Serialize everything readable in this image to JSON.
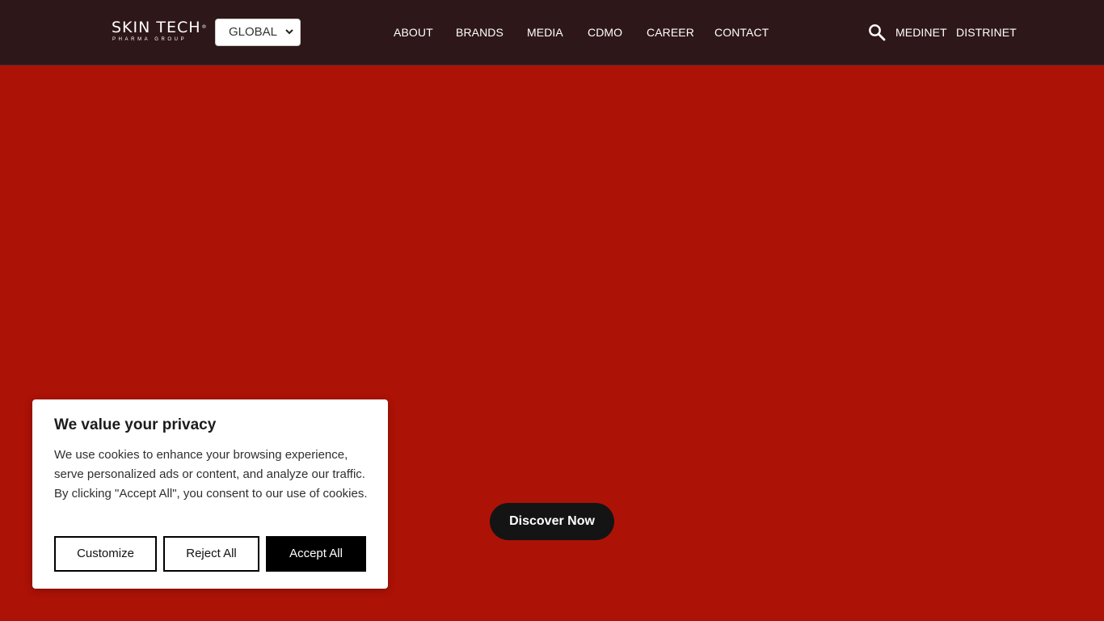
{
  "header": {
    "logo": {
      "main": "SKIN TECH",
      "registered": "®",
      "sub": "PHARMA GROUP"
    },
    "region_select": {
      "selected": "GLOBAL"
    },
    "nav": [
      {
        "label": "ABOUT"
      },
      {
        "label": "BRANDS"
      },
      {
        "label": "MEDIA"
      },
      {
        "label": "CDMO"
      },
      {
        "label": "CAREER"
      },
      {
        "label": "CONTACT"
      }
    ],
    "search_icon": "search-icon",
    "right_links": [
      {
        "label": "MEDINET"
      },
      {
        "label": "DISTRINET"
      }
    ]
  },
  "hero": {
    "cta_label": "Discover Now"
  },
  "cookie_banner": {
    "title": "We value your privacy",
    "text": "We use cookies to enhance your browsing experience, serve personalized ads or content, and analyze our traffic. By clicking \"Accept All\", you consent to our use of cookies.",
    "buttons": {
      "customize": "Customize",
      "reject": "Reject All",
      "accept": "Accept All"
    }
  },
  "colors": {
    "header_bg": "#2e1719",
    "hero_bg": "#ad1206",
    "cta_bg": "#141414",
    "accept_bg": "#000000"
  }
}
